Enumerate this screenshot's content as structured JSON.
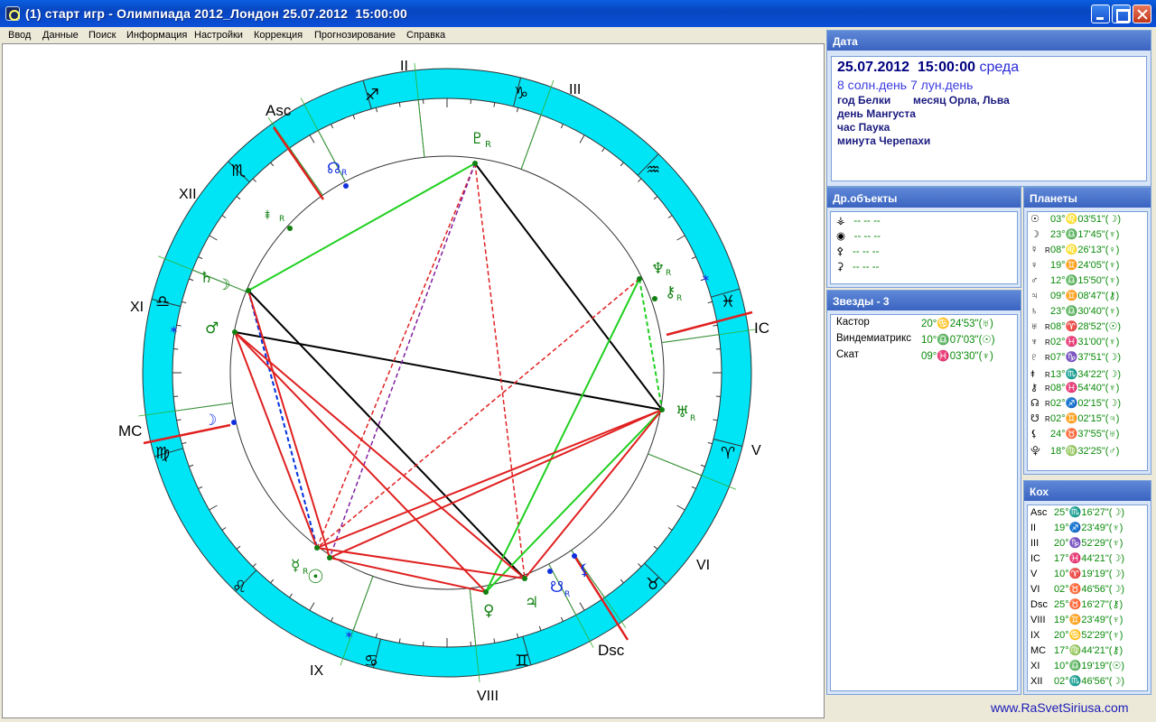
{
  "window": {
    "title": "(1) старт игр - Олимпиада 2012_Лондон 25.07.2012  15:00:00"
  },
  "menu": [
    "Ввод",
    "Данные",
    "Поиск",
    "Информация",
    "Настройки",
    "Коррекция",
    "Прогнозирование",
    "Справка"
  ],
  "date_panel": {
    "header": "Дата",
    "date": "25.07.2012",
    "time": "15:00:00",
    "weekday": "среда",
    "days": "8 солн.день 7 лун.день",
    "year": "год Белки",
    "month": "месяц Орла, Льва",
    "day": "день Мангуста",
    "hour": "час Паука",
    "minute": "минута Черепахи"
  },
  "other_objects": {
    "header": "Др.объекты",
    "rows": [
      {
        "symbol": "⚶",
        "value": "-- -- --"
      },
      {
        "symbol": "◉",
        "value": "-- -- --"
      },
      {
        "symbol": "⚴",
        "value": "-- -- --"
      },
      {
        "symbol": "⚳",
        "value": "-- -- --"
      }
    ]
  },
  "stars": {
    "header": "Звезды - 3",
    "rows": [
      {
        "name": "Кастор",
        "value": "20°♋24'53\"(♅)"
      },
      {
        "name": "Виндемиатрикс",
        "value": "10°♎07'03\"(☉)"
      },
      {
        "name": "Скат",
        "value": "09°♓03'30\"(♆)"
      }
    ]
  },
  "planets": {
    "header": "Планеты",
    "rows": [
      {
        "symbol": "☉",
        "r": "",
        "value": "03°♌03'51\"(☽)"
      },
      {
        "symbol": "☽",
        "r": "",
        "value": "23°♎17'45\"(♆)"
      },
      {
        "symbol": "☿",
        "r": "R",
        "value": "08°♌26'13\"(♀)"
      },
      {
        "symbol": "♀",
        "r": "",
        "value": "19°♊24'05\"(♆)"
      },
      {
        "symbol": "♂",
        "r": "",
        "value": "12°♎15'50\"(♆)"
      },
      {
        "symbol": "♃",
        "r": "",
        "value": "09°♊08'47\"(⚷)"
      },
      {
        "symbol": "♄",
        "r": "",
        "value": "23°♎30'40\"(♆)"
      },
      {
        "symbol": "♅",
        "r": "R",
        "value": "08°♈28'52\"(☉)"
      },
      {
        "symbol": "♆",
        "r": "R",
        "value": "02°♓31'00\"(♆)"
      },
      {
        "symbol": "♇",
        "r": "R",
        "value": "07°♑37'51\"(☽)"
      },
      {
        "symbol": "⯒",
        "r": "R",
        "value": "13°♏34'22\"(☽)"
      },
      {
        "symbol": "⚷",
        "r": "R",
        "value": "08°♓54'40\"(♆)"
      },
      {
        "symbol": "☊",
        "r": "R",
        "value": "02°♐02'15\"(☽)"
      },
      {
        "symbol": "☋",
        "r": "R",
        "value": "02°♊02'15\"(♃)"
      },
      {
        "symbol": "⚸",
        "r": "",
        "value": "24°♉37'55\"(♅)"
      },
      {
        "symbol": "⯓",
        "r": "",
        "value": "18°♍32'25\"(♂)"
      }
    ]
  },
  "houses": {
    "header": "Кох",
    "rows": [
      {
        "label": "Asc",
        "value": "25°♏16'27\"(☽)"
      },
      {
        "label": "II",
        "value": "19°♐23'49\"(♆)"
      },
      {
        "label": "III",
        "value": "20°♑52'29\"(♆)"
      },
      {
        "label": "IC",
        "value": "17°♓44'21\"(☽)"
      },
      {
        "label": "V",
        "value": "10°♈19'19\"(☽)"
      },
      {
        "label": "VI",
        "value": "02°♉46'56\"(☽)"
      },
      {
        "label": "Dsc",
        "value": "25°♉16'27\"(⚷)"
      },
      {
        "label": "VIII",
        "value": "19°♊23'49\"(♆)"
      },
      {
        "label": "IX",
        "value": "20°♋52'29\"(♆)"
      },
      {
        "label": "MC",
        "value": "17°♍44'21\"(⚷)"
      },
      {
        "label": "XI",
        "value": "10°♎19'19\"(☉)"
      },
      {
        "label": "XII",
        "value": "02°♏46'56\"(☽)"
      }
    ]
  },
  "chart": {
    "house_labels": [
      "II",
      "III",
      "IC",
      "V",
      "VI",
      "Dsc",
      "VIII",
      "IX",
      "MC",
      "XI",
      "XII",
      "Asc"
    ],
    "sign_glyphs": [
      "♐",
      "♑",
      "♒",
      "♓",
      "♈",
      "♉",
      "♊",
      "♋",
      "♌",
      "♍",
      "♎",
      "♏"
    ],
    "planet_glyphs": {
      "pluto": "♇",
      "node": "☊",
      "lilith": "⯒",
      "saturn": "♄",
      "moon": "☽",
      "mars": "♂",
      "vertex": "☽",
      "mercury": "☿",
      "sun": "☉",
      "venus": "♀",
      "jupiter": "♃",
      "southnode": "☋",
      "lilith2": "⚸",
      "neptune": "♆",
      "chiron": "⚷",
      "uranus": "♅"
    },
    "retro": "R"
  },
  "footer": "www.RaSvetSiriusa.com"
}
